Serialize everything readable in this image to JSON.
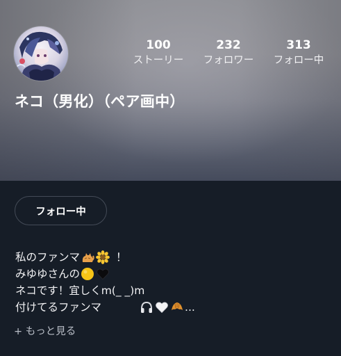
{
  "profile": {
    "display_name": "ネコ（男化）（ペア画中）",
    "avatar_icon": "anime-character-avatar"
  },
  "stats": [
    {
      "count": "100",
      "label": "ストーリー"
    },
    {
      "count": "232",
      "label": "フォロワー"
    },
    {
      "count": "313",
      "label": "フォロー中"
    }
  ],
  "follow_button": {
    "label": "フォロー中"
  },
  "bio": {
    "line1_text": "私のファンマ",
    "line1_end": "！",
    "line1_icons": [
      "cat-emoji",
      "sunflower-emoji"
    ],
    "line2_text": "みゆゆさんの",
    "line2_icons": [
      "yellow-circle-emoji",
      "black-heart-emoji"
    ],
    "line3_text": "ネコです！宜しくm(_ _)m",
    "line4_text": "付けてるファンマ",
    "line4_icons": [
      "headphone-emoji",
      "white-heart-emoji",
      "croissant-emoji"
    ],
    "line4_end": "..."
  },
  "see_more": {
    "label": "+ もっと見る"
  },
  "colors": {
    "background": "#161d27",
    "button_border": "#444b57",
    "secondary_text": "#b9bec7"
  }
}
